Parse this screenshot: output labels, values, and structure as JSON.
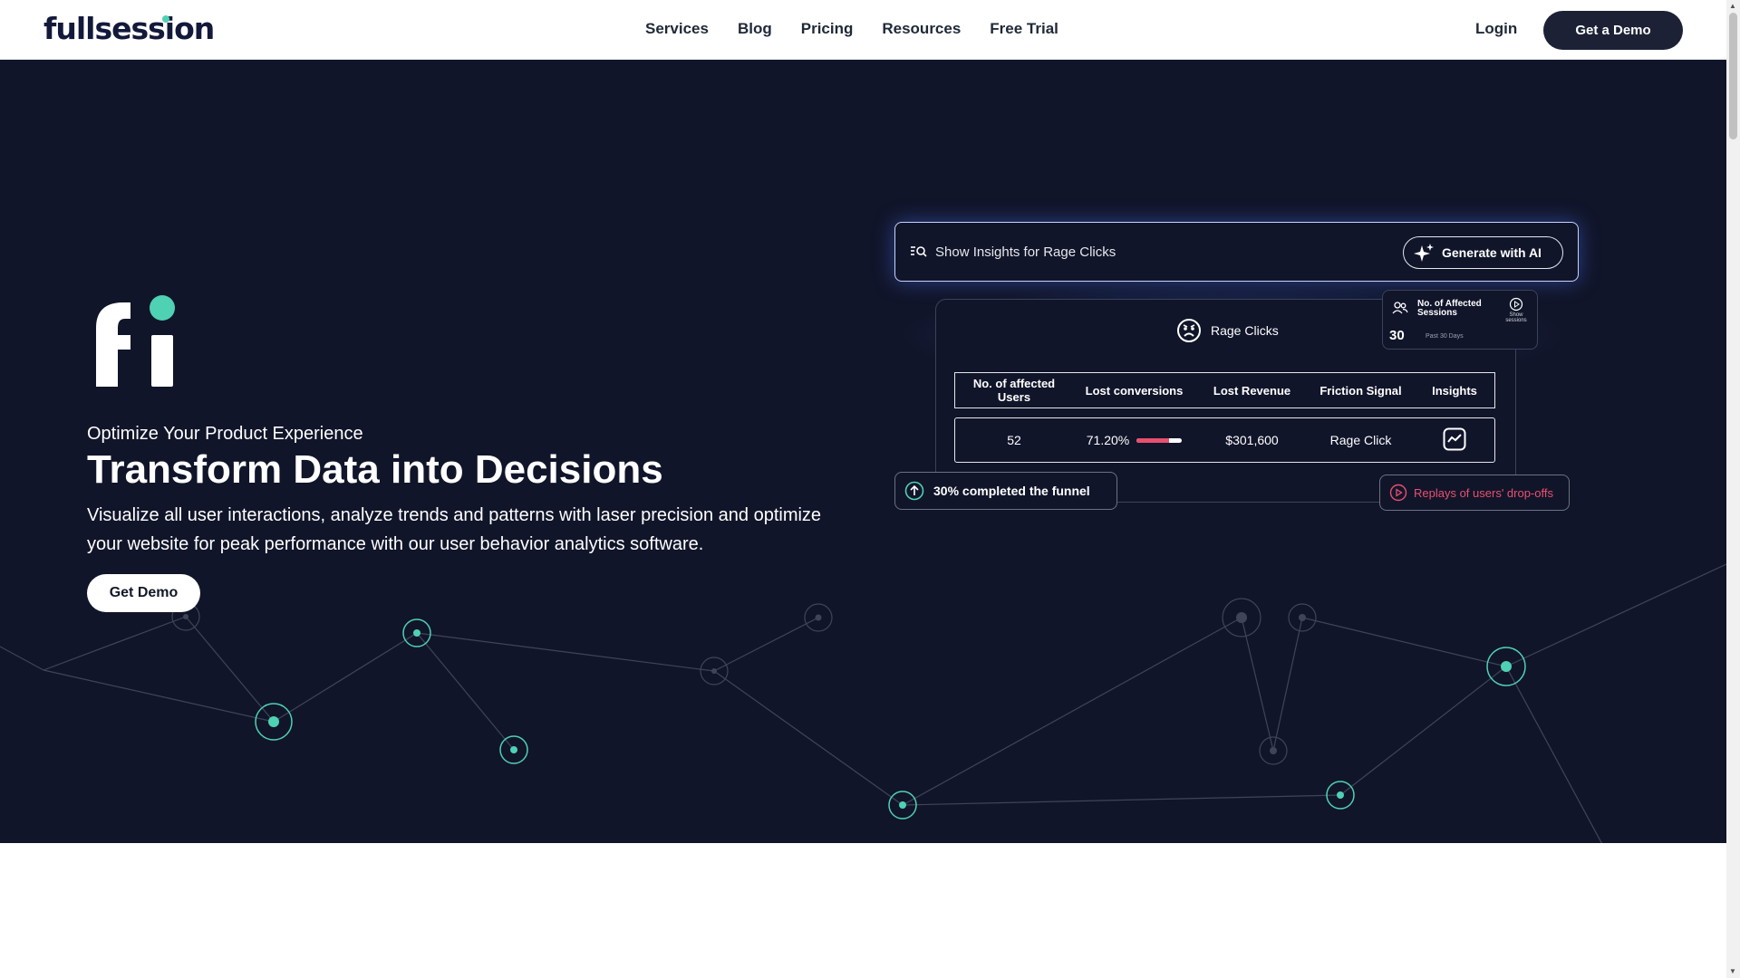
{
  "nav": {
    "logo": "fullsession",
    "links": [
      "Services",
      "Blog",
      "Pricing",
      "Resources",
      "Free Trial"
    ],
    "login": "Login",
    "cta": "Get a Demo"
  },
  "hero": {
    "eyebrow": "Optimize Your Product Experience",
    "headline": "Transform Data into Decisions",
    "description": "Visualize all user interactions, analyze trends and patterns with laser precision and optimize your website for peak performance with our user behavior analytics software.",
    "cta": "Get Demo"
  },
  "widget": {
    "search_label": "Show Insights  for Rage Clicks",
    "ai_button": "Generate with AI",
    "card_title": "Rage Clicks",
    "columns": [
      "No. of affected Users",
      "Lost conversions",
      "Lost Revenue",
      "Friction Signal",
      "Insights"
    ],
    "row": {
      "users": "52",
      "conversions": "71.20%",
      "conversion_fraction": 0.712,
      "revenue": "$301,600",
      "signal": "Rage Click"
    },
    "sessions": {
      "title": "No. of Affected Sessions",
      "value": "30",
      "period": "Past 30 Days",
      "show": "Show sessions"
    },
    "funnel": "30% completed the funnel",
    "replays": "Replays of users' drop-offs"
  },
  "colors": {
    "hero_bg": "#11152a",
    "accent_teal": "#4fd1b3",
    "accent_red": "#e8506e",
    "nav_dark": "#1c2136"
  }
}
